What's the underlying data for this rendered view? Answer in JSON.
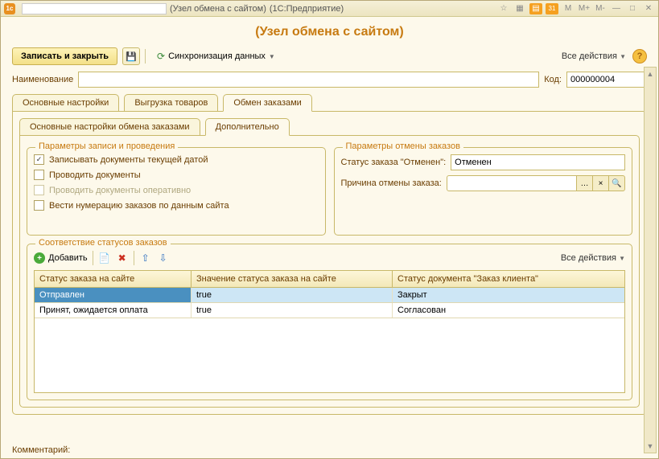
{
  "titlebar": {
    "node_text": "(Узел обмена с сайтом)",
    "app_text": "(1С:Предприятие)",
    "calendar_day": "31"
  },
  "page_title": "(Узел обмена с сайтом)",
  "toolbar": {
    "save_close": "Записать и закрыть",
    "sync": "Синхронизация данных",
    "all_actions": "Все действия"
  },
  "form": {
    "name_label": "Наименование",
    "name_value": "",
    "code_label": "Код:",
    "code_value": "000000004",
    "comment_label": "Комментарий:"
  },
  "tabs": {
    "main": "Основные настройки",
    "export": "Выгрузка товаров",
    "orders": "Обмен заказами"
  },
  "subtabs": {
    "main_orders": "Основные настройки обмена заказами",
    "additional": "Дополнительно"
  },
  "write_params": {
    "legend": "Параметры записи и проведения",
    "cb1": "Записывать документы текущей датой",
    "cb2": "Проводить документы",
    "cb3": "Проводить документы оперативно",
    "cb4": "Вести нумерацию заказов по данным сайта"
  },
  "cancel_params": {
    "legend": "Параметры отмены заказов",
    "status_label": "Статус заказа \"Отменен\":",
    "status_value": "Отменен",
    "reason_label": "Причина отмены заказа:",
    "reason_value": ""
  },
  "status_map": {
    "legend": "Соответствие статусов заказов",
    "add": "Добавить",
    "all_actions": "Все действия",
    "cols": {
      "c1": "Статус заказа на сайте",
      "c2": "Значение статуса заказа на сайте",
      "c3": "Статус документа \"Заказ клиента\""
    },
    "rows": [
      {
        "c1": "Отправлен",
        "c2": "true",
        "c3": "Закрыт"
      },
      {
        "c1": "Принят, ожидается оплата",
        "c2": "true",
        "c3": "Согласован"
      }
    ]
  }
}
